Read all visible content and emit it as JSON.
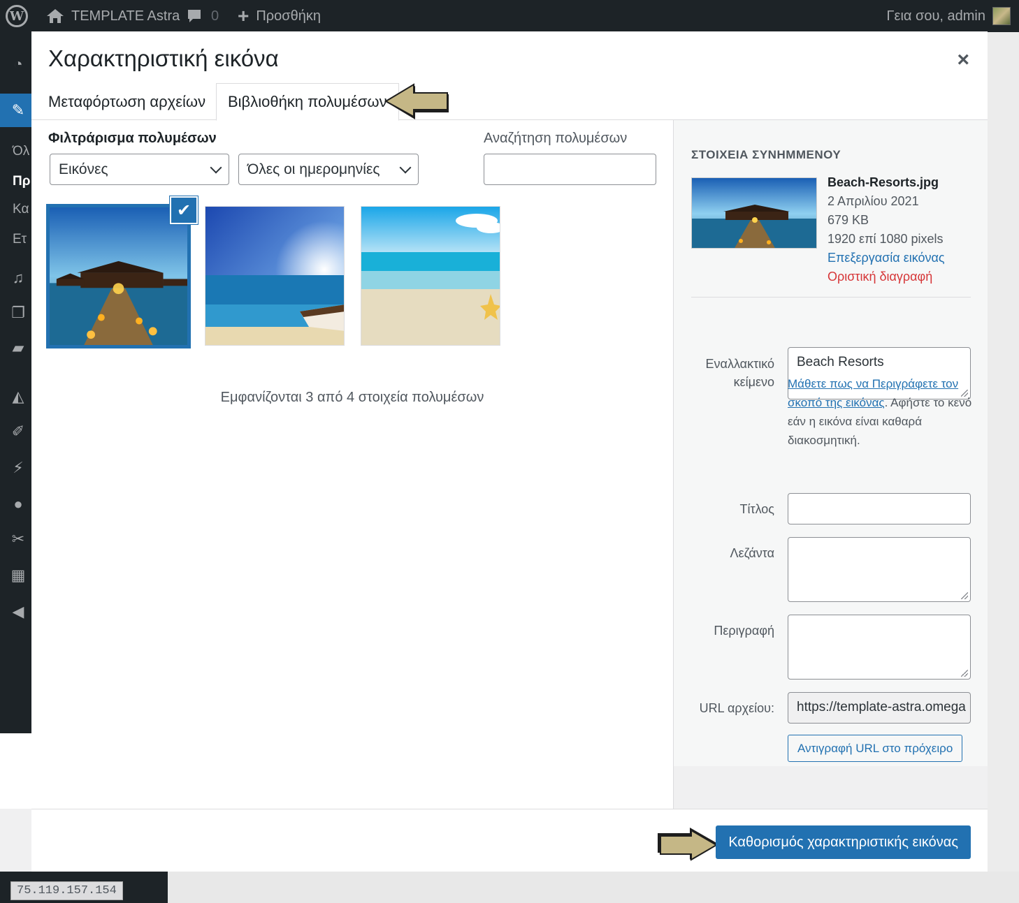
{
  "adminbar": {
    "site_name": "TEMPLATE Astra",
    "comment_count": "0",
    "new_label": "Προσθήκη",
    "greeting": "Γεια σου, admin"
  },
  "adminmenu": {
    "partial_labels": [
      "Όλ",
      "Πρ",
      "Κα",
      "Ετ"
    ]
  },
  "ip_label": "75.119.157.154",
  "modal": {
    "title": "Χαρακτηριστική εικόνα",
    "close": "×",
    "tabs": [
      {
        "label": "Μεταφόρτωση αρχείων",
        "active": false
      },
      {
        "label": "Βιβλιοθήκη πολυμέσων",
        "active": true
      }
    ],
    "filter_label": "Φιλτράρισμα πολυμέσων",
    "filter_type": {
      "selected": "Εικόνες"
    },
    "filter_date": {
      "selected": "Όλες οι ημερομηνίες"
    },
    "search_label": "Αναζήτηση πολυμέσων",
    "search_value": "",
    "count_text": "Εμφανίζονται 3 από 4 στοιχεία πολυμέσων",
    "selected_check": "✔"
  },
  "details": {
    "heading": "ΣΤΟΙΧΕΙΑ ΣΥΝΗΜΜΕΝΟΥ",
    "filename": "Beach-Resorts.jpg",
    "date": "2 Απριλίου 2021",
    "size": "679 KB",
    "dimensions": "1920 επί 1080 pixels",
    "edit_link": "Επεξεργασία εικόνας",
    "delete_link": "Οριστική διαγραφή",
    "alt_label_1": "Εναλλακτικό",
    "alt_label_2": "κείμενο",
    "alt_value": "Beach Resorts",
    "alt_help_link": "Μάθετε πως να Περιγράφετε τον σκοπό της εικόνας",
    "alt_help_text": ". Αφήστε το κενό εάν η εικόνα είναι καθαρά διακοσμητική.",
    "title_label": "Τίτλος",
    "title_value": "",
    "caption_label": "Λεζάντα",
    "caption_value": "",
    "description_label": "Περιγραφή",
    "description_value": "",
    "url_label": "URL αρχείου:",
    "url_value": "https://template-astra.omega",
    "copy_button": "Αντιγραφή URL στο πρόχειρο"
  },
  "toolbar": {
    "primary_button": "Καθορισμός χαρακτηριστικής εικόνας"
  },
  "colors": {
    "accent": "#2271b1",
    "admin_bg": "#1d2327",
    "delete": "#d63638",
    "arrow_fill": "#c5b786"
  }
}
